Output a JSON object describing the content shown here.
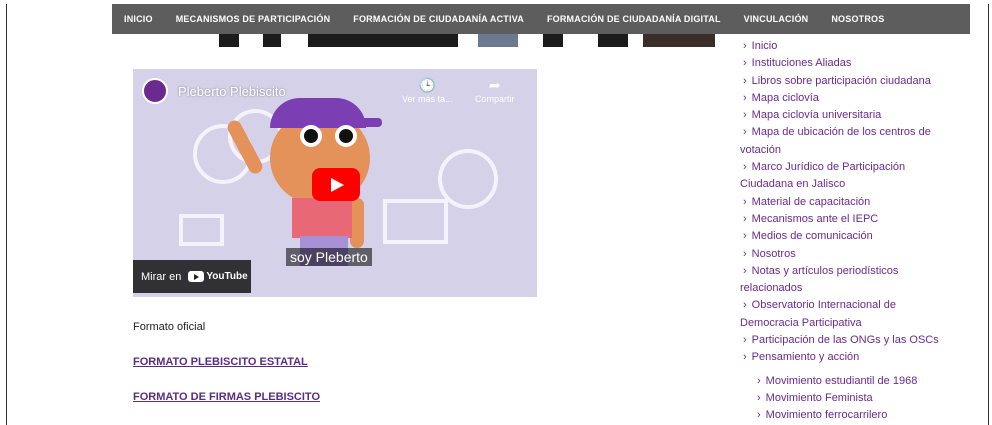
{
  "nav": {
    "items": [
      "INICIO",
      "MECANISMOS DE PARTICIPACIÓN",
      "FORMACIÓN DE CIUDADANÍA ACTIVA",
      "FORMACIÓN DE CIUDADANÍA DIGITAL",
      "VINCULACIÓN",
      "NOSOTROS"
    ]
  },
  "video": {
    "title": "Pleberto Plebiscito",
    "watch_later": "Ver más ta...",
    "share": "Compartir",
    "subtitle": "soy Pleberto",
    "watch_on": "Mirar en",
    "youtube": "YouTube"
  },
  "main": {
    "formato_oficial": "Formato oficial",
    "link_plebiscito_estatal": "FORMATO PLEBISCITO ESTATAL",
    "link_firmas_plebiscito": "FORMATO DE FIRMAS PLEBISCITO"
  },
  "sidebar": {
    "items": [
      "Inicio",
      "Instituciones Aliadas",
      "Libros sobre participación ciudadana",
      "Mapa ciclovía",
      "Mapa ciclovía universitaria",
      "Mapa de ubicación de los centros de",
      "votación",
      "Marco Jurídico de Participación",
      "Ciudadana en Jalisco",
      "Material de capacitación",
      "Mecanismos ante el IEPC",
      "Medios de comunicación",
      "Nosotros",
      "Notas y artículos periodísticos",
      "relacionados",
      "Observatorio Internacional de",
      "Democracia Participativa",
      "Participación de las ONGs y las OSCs",
      "Pensamiento y acción"
    ],
    "subitems": [
      "Movimiento estudiantil de 1968",
      "Movimiento Feminista",
      "Movimiento ferrocarrilero"
    ]
  },
  "colors": {
    "nav_bg": "#5d5d5d",
    "link": "#5a2d82",
    "sidebar_link": "#6b2a8f",
    "youtube_red": "#ff0000"
  }
}
